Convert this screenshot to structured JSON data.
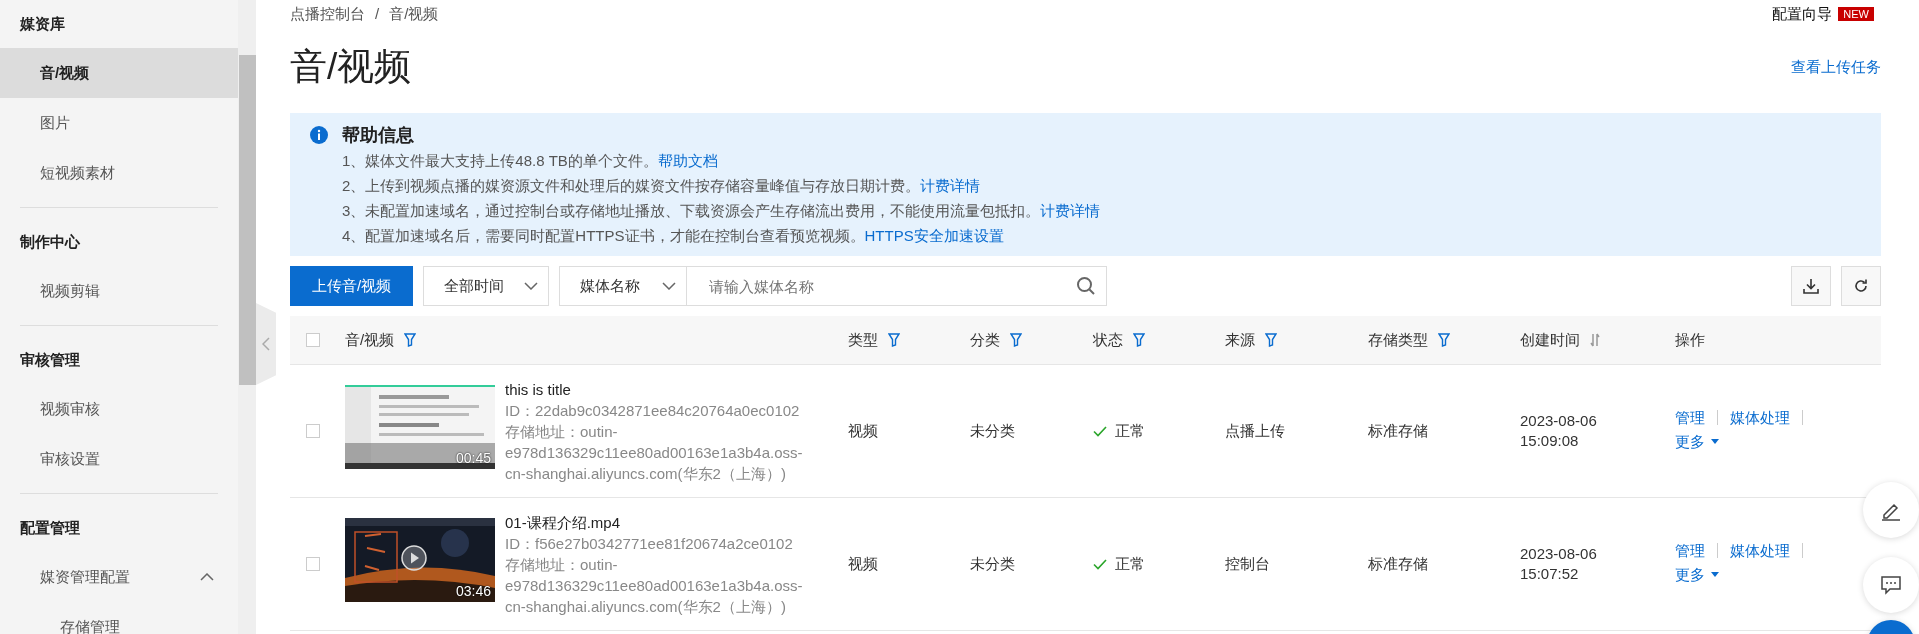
{
  "sidebar": {
    "sections": [
      {
        "title": "媒资库",
        "items": [
          {
            "label": "音/视频",
            "selected": true
          },
          {
            "label": "图片",
            "selected": false
          },
          {
            "label": "短视频素材",
            "selected": false
          }
        ]
      },
      {
        "title": "制作中心",
        "items": [
          {
            "label": "视频剪辑",
            "selected": false
          }
        ]
      },
      {
        "title": "审核管理",
        "items": [
          {
            "label": "视频审核",
            "selected": false
          },
          {
            "label": "审核设置",
            "selected": false
          }
        ]
      },
      {
        "title": "配置管理",
        "items": [
          {
            "label": "媒资管理配置",
            "selected": false,
            "expanded": true,
            "children": [
              {
                "label": "存储管理",
                "selected": false
              }
            ]
          }
        ]
      }
    ]
  },
  "breadcrumb": {
    "items": [
      "点播控制台",
      "音/视频"
    ],
    "separator": "/"
  },
  "header": {
    "guide": "配置向导",
    "badge": "NEW",
    "title": "音/视频",
    "upload_tasks_link": "查看上传任务"
  },
  "help": {
    "title": "帮助信息",
    "lines": [
      {
        "text": "1、媒体文件最大支持上传48.8 TB的单个文件。",
        "link": "帮助文档"
      },
      {
        "text": "2、上传到视频点播的媒资源文件和处理后的媒资文件按存储容量峰值与存放日期计费。",
        "link": "计费详情"
      },
      {
        "text": "3、未配置加速域名，通过控制台或存储地址播放、下载资源会产生存储流出费用，不能使用流量包抵扣。",
        "link": "计费详情"
      },
      {
        "text": "4、配置加速域名后，需要同时配置HTTPS证书，才能在控制台查看预览视频。",
        "link": "HTTPS安全加速设置"
      }
    ]
  },
  "toolbar": {
    "upload_button": "上传音/视频",
    "time_filter": "全部时间",
    "search_type": "媒体名称",
    "search": {
      "placeholder": "请输入媒体名称"
    }
  },
  "table": {
    "all_checked": false,
    "columns": [
      {
        "label": "音/视频",
        "kind": "filter"
      },
      {
        "label": "类型",
        "kind": "filter"
      },
      {
        "label": "分类",
        "kind": "filter"
      },
      {
        "label": "状态",
        "kind": "filter"
      },
      {
        "label": "来源",
        "kind": "filter"
      },
      {
        "label": "存储类型",
        "kind": "filter"
      },
      {
        "label": "创建时间",
        "kind": "sort"
      },
      {
        "label": "操作",
        "kind": "plain"
      }
    ],
    "rows": [
      {
        "checked": false,
        "playable": false,
        "duration": "00:45",
        "title": "this is title",
        "id": "ID：22dab9c0342871ee84c20764a0ec0102",
        "storage_address": "存储地址：outin-e978d136329c11ee80ad00163e1a3b4a.oss-cn-shanghai.aliyuncs.com(华东2（上海）)",
        "type": "视频",
        "category": "未分类",
        "status": "正常",
        "source": "点播上传",
        "storage_type": "标准存储",
        "created_date": "2023-08-06",
        "created_time": "15:09:08",
        "actions": [
          "管理",
          "媒体处理"
        ],
        "more": "更多"
      },
      {
        "checked": false,
        "playable": true,
        "duration": "03:46",
        "title": "01-课程介绍.mp4",
        "id": "ID：f56e27b0342771ee81f20674a2ce0102",
        "storage_address": "存储地址：outin-e978d136329c11ee80ad00163e1a3b4a.oss-cn-shanghai.aliyuncs.com(华东2（上海）)",
        "type": "视频",
        "category": "未分类",
        "status": "正常",
        "source": "控制台",
        "storage_type": "标准存储",
        "created_date": "2023-08-06",
        "created_time": "15:07:52",
        "actions": [
          "管理",
          "媒体处理"
        ],
        "more": "更多"
      }
    ]
  }
}
